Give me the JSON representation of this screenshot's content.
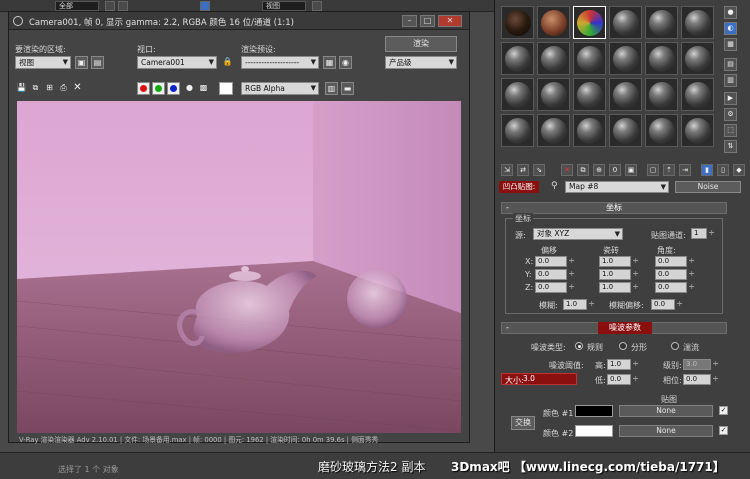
{
  "topbar": {
    "select1": "全部",
    "select2": "视图"
  },
  "status": {
    "text": "选择了 1 个 对象"
  },
  "caption": {
    "text": "磨砂玻璃方法2 副本",
    "brand": "3Dmax吧 【www.linecg.com/tieba/1771】"
  },
  "render_window": {
    "title": "Camera001, 帧 0, 显示 gamma: 2.2, RGBA 颜色 16 位/通道 (1:1)",
    "area_label": "要渲染的区域:",
    "area_value": "视图",
    "viewport_label": "视口:",
    "viewport_value": "Camera001",
    "preset_label": "渲染预设:",
    "preset_value": "--------------------",
    "render_button": "渲染",
    "quality_value": "产品级",
    "channel_value": "RGB Alpha",
    "info": "V-Ray 渲染渲染器 Adv 2.10.01 | 文件: 场景备用.max | 帧: 0000 | 图元: 1962 | 渲染时间: 0h 0m 39.6s | 侧面秀秀"
  },
  "material_editor": {
    "map_label": "凹凸贴图:",
    "map_name": "Map #8",
    "map_type": "Noise",
    "coords": {
      "title": "坐标",
      "group": "坐标",
      "source_label": "源:",
      "source_value": "对象 XYZ",
      "channel_label": "贴图通道:",
      "channel_value": "1",
      "offset_label": "偏移",
      "tiling_label": "瓷砖",
      "angle_label": "角度:",
      "x": "X:",
      "y": "Y:",
      "z": "Z:",
      "offset": [
        "0.0",
        "0.0",
        "0.0"
      ],
      "tiling": [
        "1.0",
        "1.0",
        "1.0"
      ],
      "angle": [
        "0.0",
        "0.0",
        "0.0"
      ],
      "blur_label": "模糊:",
      "blur_value": "1.0",
      "blur_offset_label": "模糊偏移:",
      "blur_offset_value": "0.0"
    },
    "noise": {
      "title": "噪波参数",
      "type_label": "噪波类型:",
      "type_regular": "规则",
      "type_fractal": "分形",
      "type_turbulence": "湍流",
      "threshold_label": "噪波阈值:",
      "high_label": "高:",
      "high_value": "1.0",
      "levels_label": "级别:",
      "levels_value": "3.0",
      "size_label": "大小:",
      "size_value": "3.0",
      "low_label": "低:",
      "low_value": "0.0",
      "phase_label": "相位:",
      "phase_value": "0.0",
      "maps_label": "贴图",
      "swap_button": "交换",
      "color1_label": "颜色 #1",
      "color2_label": "颜色 #2",
      "none1": "None",
      "none2": "None"
    }
  },
  "colors": {
    "accent_red": "#8a1010",
    "render_pink": "#dcaad3"
  }
}
